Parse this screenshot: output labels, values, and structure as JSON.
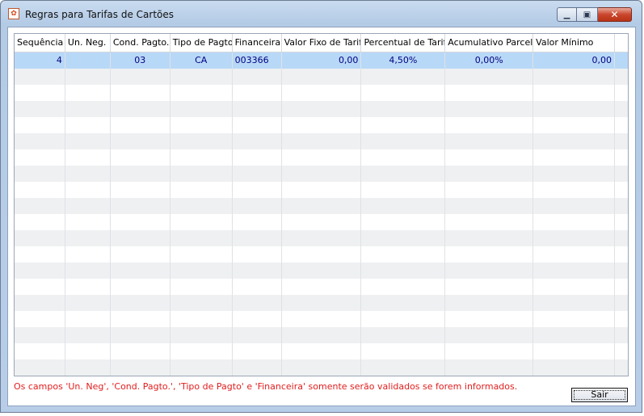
{
  "window": {
    "title": "Regras para Tarifas de Cartões",
    "icon": "app-icon",
    "controls": [
      "minimize-icon",
      "maximize-icon",
      "close-icon"
    ]
  },
  "grid": {
    "columns": [
      "Sequência",
      "Un. Neg.",
      "Cond. Pagto.",
      "Tipo de Pagto",
      "Financeira",
      "Valor Fixo de Tarifa",
      "Percentual de Tarifa",
      "Acumulativo Parcela",
      "Valor Mínimo"
    ],
    "rows": [
      [
        "4",
        "",
        "03",
        "CA",
        "003366",
        "0,00",
        "4,50%",
        "0,00%",
        "0,00"
      ]
    ]
  },
  "footer": {
    "note": "Os campos 'Un. Neg', 'Cond. Pagto.', 'Tipo de Pagto' e 'Financeira' somente serão validados se forem informados.",
    "exit_label": "Sair"
  },
  "colors": {
    "note": "#e11d1d",
    "selected_row": "#b8d8f7",
    "cell_text": "#000080"
  }
}
